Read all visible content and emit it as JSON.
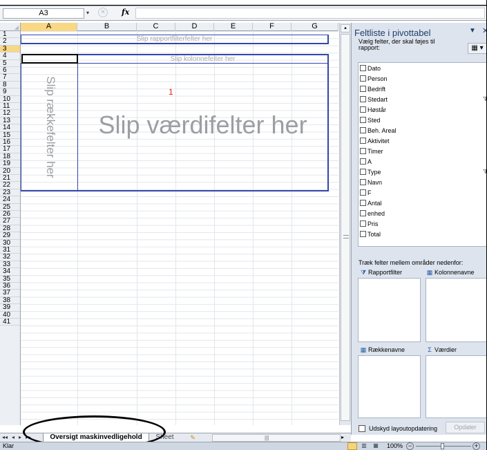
{
  "formula_bar": {
    "name_box": "A3",
    "name_arrow": "▾",
    "cancel_glyph": "✕",
    "fx": "fx"
  },
  "columns": [
    {
      "label": "A",
      "selected": true
    },
    {
      "label": "B"
    },
    {
      "label": "C"
    },
    {
      "label": "D"
    },
    {
      "label": "E"
    },
    {
      "label": "F"
    },
    {
      "label": "G"
    }
  ],
  "rows": [
    "1",
    "2",
    "3",
    "4",
    "5",
    "6",
    "7",
    "8",
    "9",
    "10",
    "11",
    "12",
    "13",
    "14",
    "15",
    "16",
    "17",
    "18",
    "19",
    "20",
    "21",
    "22",
    "23",
    "24",
    "25",
    "26",
    "27",
    "28",
    "29",
    "30",
    "31",
    "32",
    "33",
    "34",
    "35",
    "36",
    "37",
    "38",
    "39",
    "40",
    "41"
  ],
  "selected_row": "3",
  "pivot": {
    "report_filter_placeholder": "Slip rapportfilterfelter her",
    "column_placeholder": "Slip kolonnefelter her",
    "row_placeholder": "Slip rækkefelter her",
    "values_placeholder": "Slip værdifelter her",
    "annotation": "1"
  },
  "field_pane": {
    "title": "Feltliste i pivottabel",
    "menu_glyph": "▼",
    "close_glyph": "✕",
    "instruction": "Vælg felter, der skal føjes til rapport:",
    "layout_glyph": "▦ ▾",
    "fields": [
      {
        "label": "Dato"
      },
      {
        "label": "Person"
      },
      {
        "label": "Bedrift"
      },
      {
        "label": "Stedart",
        "filtered": true
      },
      {
        "label": "Høstår"
      },
      {
        "label": "Sted"
      },
      {
        "label": "Beh. Areal"
      },
      {
        "label": "Aktivitet"
      },
      {
        "label": "Timer"
      },
      {
        "label": "A"
      },
      {
        "label": "Type",
        "filtered": true
      },
      {
        "label": "Navn"
      },
      {
        "label": "F"
      },
      {
        "label": "Antal"
      },
      {
        "label": "enhed"
      },
      {
        "label": "Pris"
      },
      {
        "label": "Total"
      }
    ],
    "filter_glyph": "⧩",
    "areas_instruction": "Træk felter mellem områder nedenfor:",
    "areas": {
      "report_filter": "Rapportfilter",
      "column_labels": "Kolonnenavne",
      "row_labels": "Rækkenavne",
      "values": "Værdier"
    },
    "area_glyphs": {
      "filter": "⧩",
      "grid": "▦",
      "sigma": "Σ"
    },
    "defer_label": "Udskyd layoutopdatering",
    "update_button": "Opdater"
  },
  "tabs": {
    "nav_first": "◂◂",
    "nav_prev": "◂",
    "nav_next": "▸",
    "nav_last": "▸▸",
    "active": "Oversigt maskinvedligehold",
    "second": "Sheet",
    "insert_glyph": "✎",
    "hscroll_grip": "|||",
    "hscroll_right": "▸"
  },
  "status": {
    "ready": "Klar",
    "zoom": "100%",
    "zoom_out": "−",
    "zoom_in": "+",
    "view_layout_glyph": "▥",
    "view_break_glyph": "▦"
  },
  "scrollbar": {
    "up_glyph": "▴"
  }
}
